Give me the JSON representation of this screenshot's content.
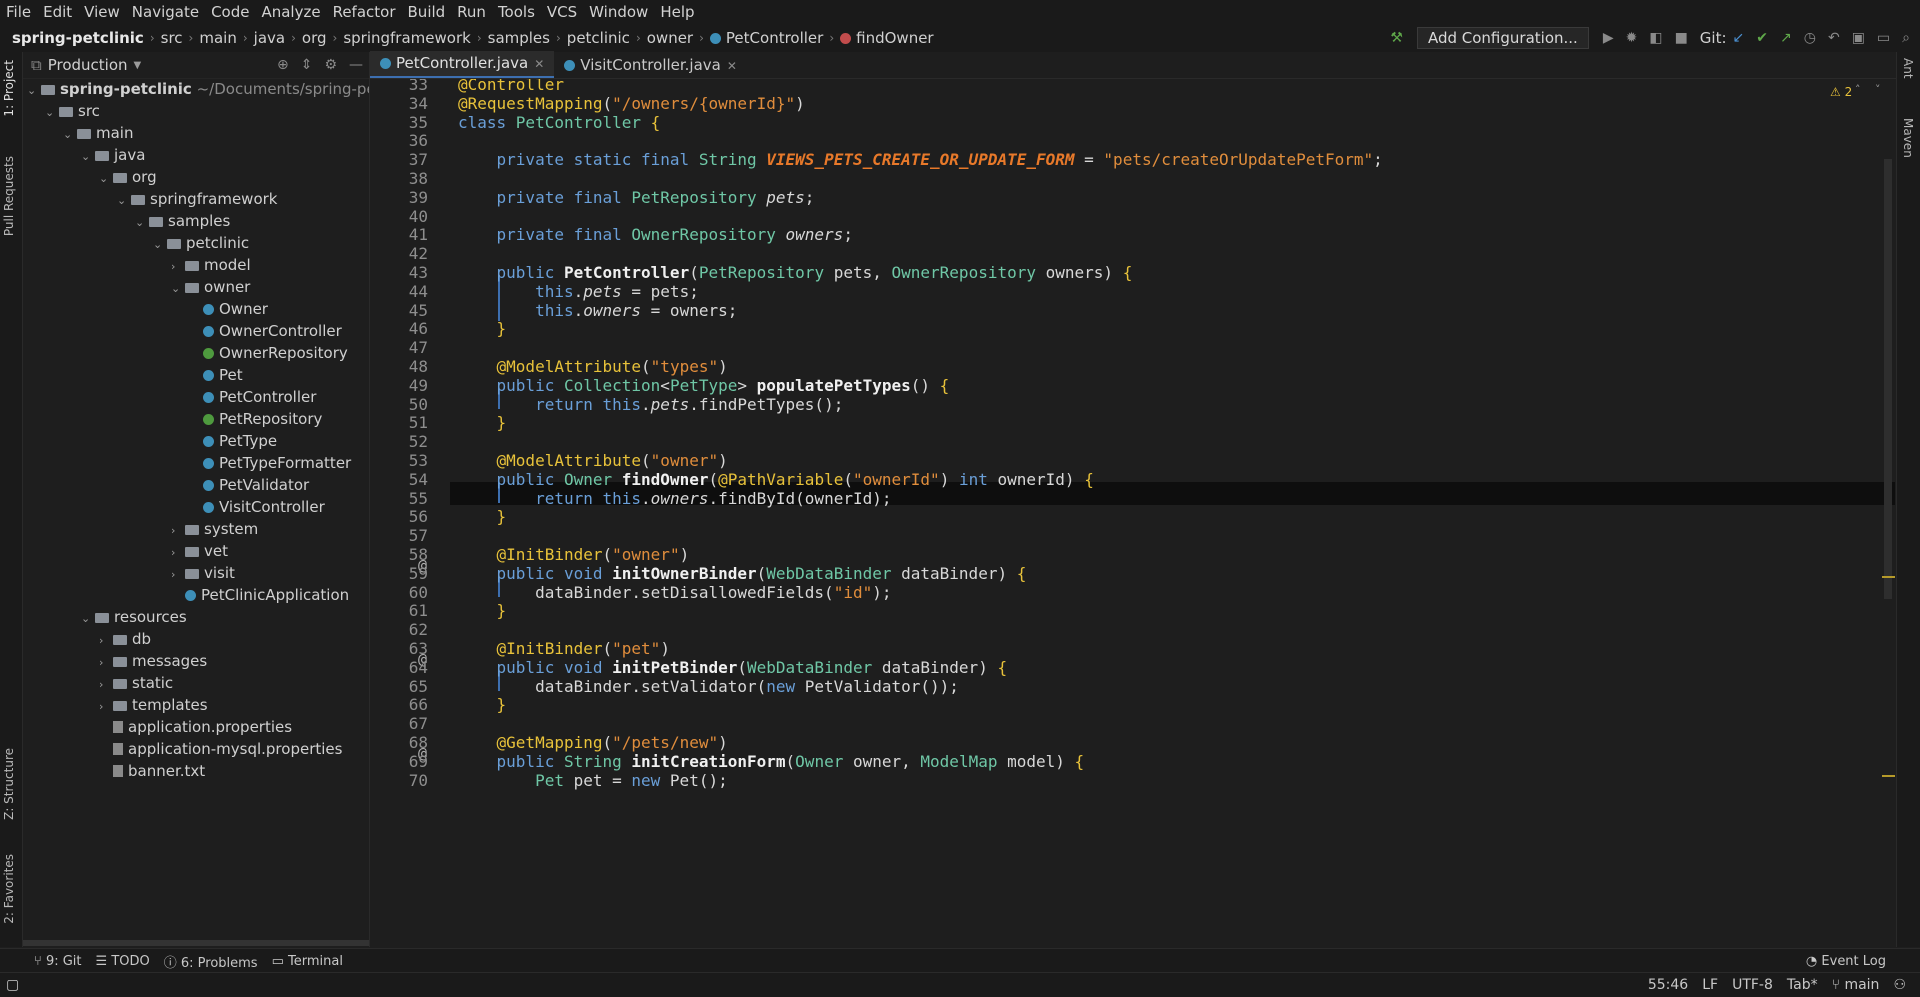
{
  "menu": [
    "File",
    "Edit",
    "View",
    "Navigate",
    "Code",
    "Analyze",
    "Refactor",
    "Build",
    "Run",
    "Tools",
    "VCS",
    "Window",
    "Help"
  ],
  "breadcrumb": {
    "root": "spring-petclinic",
    "items": [
      "src",
      "main",
      "java",
      "org",
      "springframework",
      "samples",
      "petclinic",
      "owner"
    ],
    "class_name": "PetController",
    "method_name": "findOwner"
  },
  "toolbar": {
    "add_config": "Add Configuration...",
    "git_label": "Git:"
  },
  "left_tabs": [
    "1: Project",
    "Pull Requests",
    "Z: Structure",
    "2: Favorites"
  ],
  "right_tabs": [
    "Ant",
    "Maven"
  ],
  "project_panel": {
    "title": "Production",
    "root_label": "spring-petclinic",
    "root_path": "~/Documents/spring-petclinic",
    "tree": [
      {
        "label": "src",
        "depth": 1,
        "kind": "folder",
        "open": true
      },
      {
        "label": "main",
        "depth": 2,
        "kind": "folder",
        "open": true
      },
      {
        "label": "java",
        "depth": 3,
        "kind": "folder",
        "open": true
      },
      {
        "label": "org",
        "depth": 4,
        "kind": "folder",
        "open": true
      },
      {
        "label": "springframework",
        "depth": 5,
        "kind": "folder",
        "open": true
      },
      {
        "label": "samples",
        "depth": 6,
        "kind": "folder",
        "open": true
      },
      {
        "label": "petclinic",
        "depth": 7,
        "kind": "folder",
        "open": true
      },
      {
        "label": "model",
        "depth": 8,
        "kind": "folder",
        "open": false
      },
      {
        "label": "owner",
        "depth": 8,
        "kind": "folder",
        "open": true
      },
      {
        "label": "Owner",
        "depth": 9,
        "kind": "class"
      },
      {
        "label": "OwnerController",
        "depth": 9,
        "kind": "class"
      },
      {
        "label": "OwnerRepository",
        "depth": 9,
        "kind": "interface"
      },
      {
        "label": "Pet",
        "depth": 9,
        "kind": "class"
      },
      {
        "label": "PetController",
        "depth": 9,
        "kind": "class"
      },
      {
        "label": "PetRepository",
        "depth": 9,
        "kind": "interface"
      },
      {
        "label": "PetType",
        "depth": 9,
        "kind": "class"
      },
      {
        "label": "PetTypeFormatter",
        "depth": 9,
        "kind": "class"
      },
      {
        "label": "PetValidator",
        "depth": 9,
        "kind": "class"
      },
      {
        "label": "VisitController",
        "depth": 9,
        "kind": "class"
      },
      {
        "label": "system",
        "depth": 8,
        "kind": "folder",
        "open": false
      },
      {
        "label": "vet",
        "depth": 8,
        "kind": "folder",
        "open": false
      },
      {
        "label": "visit",
        "depth": 8,
        "kind": "folder",
        "open": false
      },
      {
        "label": "PetClinicApplication",
        "depth": 8,
        "kind": "class"
      },
      {
        "label": "resources",
        "depth": 3,
        "kind": "folder",
        "open": true
      },
      {
        "label": "db",
        "depth": 4,
        "kind": "folder",
        "open": false
      },
      {
        "label": "messages",
        "depth": 4,
        "kind": "folder",
        "open": false
      },
      {
        "label": "static",
        "depth": 4,
        "kind": "folder",
        "open": false
      },
      {
        "label": "templates",
        "depth": 4,
        "kind": "folder",
        "open": false
      },
      {
        "label": "application.properties",
        "depth": 4,
        "kind": "file"
      },
      {
        "label": "application-mysql.properties",
        "depth": 4,
        "kind": "file"
      },
      {
        "label": "banner.txt",
        "depth": 4,
        "kind": "file"
      }
    ]
  },
  "editor_tabs": [
    {
      "label": "PetController.java",
      "active": true
    },
    {
      "label": "VisitController.java",
      "active": false
    }
  ],
  "inspection": {
    "warnings": "2"
  },
  "code_lines": [
    {
      "n": "33",
      "segs": [
        [
          "an",
          "@Controller"
        ]
      ]
    },
    {
      "n": "34",
      "segs": [
        [
          "an",
          "@RequestMapping"
        ],
        [
          "",
          "("
        ],
        [
          "st",
          "\"/owners/{ownerId}\""
        ],
        [
          "",
          ")"
        ]
      ]
    },
    {
      "n": "35",
      "segs": [
        [
          "kw",
          "class "
        ],
        [
          "ty",
          "PetController "
        ],
        [
          "br",
          "{"
        ]
      ]
    },
    {
      "n": "36",
      "segs": []
    },
    {
      "n": "37",
      "segs": [
        [
          "",
          "    "
        ],
        [
          "kw",
          "private static final "
        ],
        [
          "ty",
          "String "
        ],
        [
          "cst",
          "VIEWS_PETS_CREATE_OR_UPDATE_FORM"
        ],
        [
          "",
          " = "
        ],
        [
          "st",
          "\"pets/createOrUpdatePetForm\""
        ],
        [
          "",
          ";"
        ]
      ]
    },
    {
      "n": "38",
      "segs": []
    },
    {
      "n": "39",
      "segs": [
        [
          "",
          "    "
        ],
        [
          "kw",
          "private final "
        ],
        [
          "ty",
          "PetRepository "
        ],
        [
          "it",
          "pets"
        ],
        [
          "",
          ";"
        ]
      ]
    },
    {
      "n": "40",
      "segs": []
    },
    {
      "n": "41",
      "segs": [
        [
          "",
          "    "
        ],
        [
          "kw",
          "private final "
        ],
        [
          "ty",
          "OwnerRepository "
        ],
        [
          "it",
          "owners"
        ],
        [
          "",
          ";"
        ]
      ]
    },
    {
      "n": "42",
      "segs": []
    },
    {
      "n": "43",
      "segs": [
        [
          "",
          "    "
        ],
        [
          "kw",
          "public "
        ],
        [
          "fn",
          "PetController"
        ],
        [
          "",
          "("
        ],
        [
          "ty",
          "PetRepository "
        ],
        [
          "",
          "pets, "
        ],
        [
          "ty",
          "OwnerRepository "
        ],
        [
          "",
          "owners) "
        ],
        [
          "br",
          "{"
        ]
      ]
    },
    {
      "n": "44",
      "segs": [
        [
          "",
          "        "
        ],
        [
          "kw",
          "this"
        ],
        [
          "",
          "."
        ],
        [
          "it",
          "pets"
        ],
        [
          "",
          " = pets;"
        ]
      ]
    },
    {
      "n": "45",
      "segs": [
        [
          "",
          "        "
        ],
        [
          "kw",
          "this"
        ],
        [
          "",
          "."
        ],
        [
          "it",
          "owners"
        ],
        [
          "",
          " = owners;"
        ]
      ]
    },
    {
      "n": "46",
      "segs": [
        [
          "",
          "    "
        ],
        [
          "br",
          "}"
        ]
      ]
    },
    {
      "n": "47",
      "segs": []
    },
    {
      "n": "48",
      "segs": [
        [
          "",
          "    "
        ],
        [
          "an",
          "@ModelAttribute"
        ],
        [
          "",
          "("
        ],
        [
          "st",
          "\"types\""
        ],
        [
          "",
          ")"
        ]
      ]
    },
    {
      "n": "49",
      "segs": [
        [
          "",
          "    "
        ],
        [
          "kw",
          "public "
        ],
        [
          "ty",
          "Collection"
        ],
        [
          "",
          "<"
        ],
        [
          "ty",
          "PetType"
        ],
        [
          "",
          "> "
        ],
        [
          "fn",
          "populatePetTypes"
        ],
        [
          "",
          "() "
        ],
        [
          "br",
          "{"
        ]
      ]
    },
    {
      "n": "50",
      "segs": [
        [
          "",
          "        "
        ],
        [
          "kw",
          "return this"
        ],
        [
          "",
          "."
        ],
        [
          "it",
          "pets"
        ],
        [
          "",
          ".findPetTypes();"
        ]
      ]
    },
    {
      "n": "51",
      "segs": [
        [
          "",
          "    "
        ],
        [
          "br",
          "}"
        ]
      ]
    },
    {
      "n": "52",
      "segs": []
    },
    {
      "n": "53",
      "segs": [
        [
          "",
          "    "
        ],
        [
          "an",
          "@ModelAttribute"
        ],
        [
          "",
          "("
        ],
        [
          "st",
          "\"owner\""
        ],
        [
          "",
          ")"
        ]
      ]
    },
    {
      "n": "54",
      "segs": [
        [
          "",
          "    "
        ],
        [
          "kw",
          "public "
        ],
        [
          "ty",
          "Owner "
        ],
        [
          "fn",
          "findOwner"
        ],
        [
          "",
          "("
        ],
        [
          "an",
          "@PathVariable"
        ],
        [
          "",
          "("
        ],
        [
          "st",
          "\"ownerId\""
        ],
        [
          "",
          ") "
        ],
        [
          "kw",
          "int "
        ],
        [
          "",
          "ownerId) "
        ],
        [
          "br",
          "{"
        ]
      ]
    },
    {
      "n": "55",
      "segs": [
        [
          "",
          "        "
        ],
        [
          "kw",
          "return this"
        ],
        [
          "",
          "."
        ],
        [
          "it",
          "owners"
        ],
        [
          "",
          ".findById(ownerId);"
        ]
      ]
    },
    {
      "n": "56",
      "segs": [
        [
          "",
          "    "
        ],
        [
          "br",
          "}"
        ]
      ]
    },
    {
      "n": "57",
      "segs": []
    },
    {
      "n": "58",
      "segs": [
        [
          "",
          "    "
        ],
        [
          "an",
          "@InitBinder"
        ],
        [
          "",
          "("
        ],
        [
          "st",
          "\"owner\""
        ],
        [
          "",
          ")"
        ]
      ]
    },
    {
      "n": "59",
      "segs": [
        [
          "",
          "    "
        ],
        [
          "kw",
          "public void "
        ],
        [
          "fn",
          "initOwnerBinder"
        ],
        [
          "",
          "("
        ],
        [
          "ty",
          "WebDataBinder "
        ],
        [
          "",
          "dataBinder) "
        ],
        [
          "br",
          "{"
        ]
      ]
    },
    {
      "n": "60",
      "segs": [
        [
          "",
          "        dataBinder.setDisallowedFields("
        ],
        [
          "st",
          "\"id\""
        ],
        [
          "",
          ");"
        ]
      ]
    },
    {
      "n": "61",
      "segs": [
        [
          "",
          "    "
        ],
        [
          "br",
          "}"
        ]
      ]
    },
    {
      "n": "62",
      "segs": []
    },
    {
      "n": "63",
      "segs": [
        [
          "",
          "    "
        ],
        [
          "an",
          "@InitBinder"
        ],
        [
          "",
          "("
        ],
        [
          "st",
          "\"pet\""
        ],
        [
          "",
          ")"
        ]
      ]
    },
    {
      "n": "64",
      "segs": [
        [
          "",
          "    "
        ],
        [
          "kw",
          "public void "
        ],
        [
          "fn",
          "initPetBinder"
        ],
        [
          "",
          "("
        ],
        [
          "ty",
          "WebDataBinder "
        ],
        [
          "",
          "dataBinder) "
        ],
        [
          "br",
          "{"
        ]
      ]
    },
    {
      "n": "65",
      "segs": [
        [
          "",
          "        dataBinder.setValidator("
        ],
        [
          "kw",
          "new "
        ],
        [
          "",
          "PetValidator());"
        ]
      ]
    },
    {
      "n": "66",
      "segs": [
        [
          "",
          "    "
        ],
        [
          "br",
          "}"
        ]
      ]
    },
    {
      "n": "67",
      "segs": []
    },
    {
      "n": "68",
      "segs": [
        [
          "",
          "    "
        ],
        [
          "an",
          "@GetMapping"
        ],
        [
          "",
          "("
        ],
        [
          "st",
          "\"/pets/new\""
        ],
        [
          "",
          ")"
        ]
      ]
    },
    {
      "n": "69",
      "segs": [
        [
          "",
          "    "
        ],
        [
          "kw",
          "public "
        ],
        [
          "ty",
          "String "
        ],
        [
          "fn",
          "initCreationForm"
        ],
        [
          "",
          "("
        ],
        [
          "ty",
          "Owner "
        ],
        [
          "",
          "owner, "
        ],
        [
          "ty",
          "ModelMap "
        ],
        [
          "",
          "model) "
        ],
        [
          "br",
          "{"
        ]
      ]
    },
    {
      "n": "70",
      "segs": [
        [
          "",
          "        "
        ],
        [
          "ty",
          "Pet "
        ],
        [
          "",
          "pet = "
        ],
        [
          "kw",
          "new "
        ],
        [
          "",
          "Pet();"
        ]
      ]
    }
  ],
  "bottom_tabs": [
    "9: Git",
    "TODO",
    "6: Problems",
    "Terminal"
  ],
  "event_log": "Event Log",
  "status": {
    "position": "55:46",
    "line_sep": "LF",
    "encoding": "UTF-8",
    "indent": "Tab*",
    "branch": "main"
  }
}
